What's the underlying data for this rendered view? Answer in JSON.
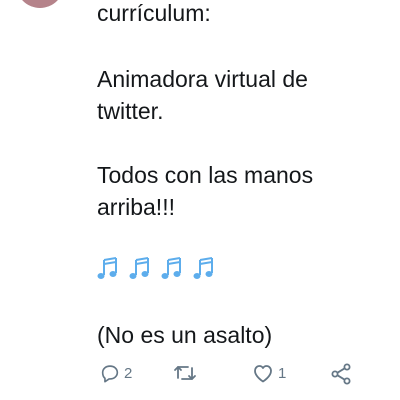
{
  "tweet": {
    "lines": [
      "currículum:",
      "Animadora virtual de",
      "twitter.",
      "Todos con las manos",
      "arriba!!!",
      "(No es un asalto)"
    ],
    "emoji_icons": [
      "music-notes-icon",
      "music-notes-icon",
      "music-notes-icon",
      "music-notes-icon"
    ],
    "emoji_color": "#5dadec"
  },
  "actions": {
    "reply_count": "2",
    "retweet_count": "",
    "like_count": "1",
    "share_icon": "share-icon"
  },
  "colors": {
    "text": "#14171a",
    "muted": "#657786",
    "avatar": "#b5838a"
  }
}
